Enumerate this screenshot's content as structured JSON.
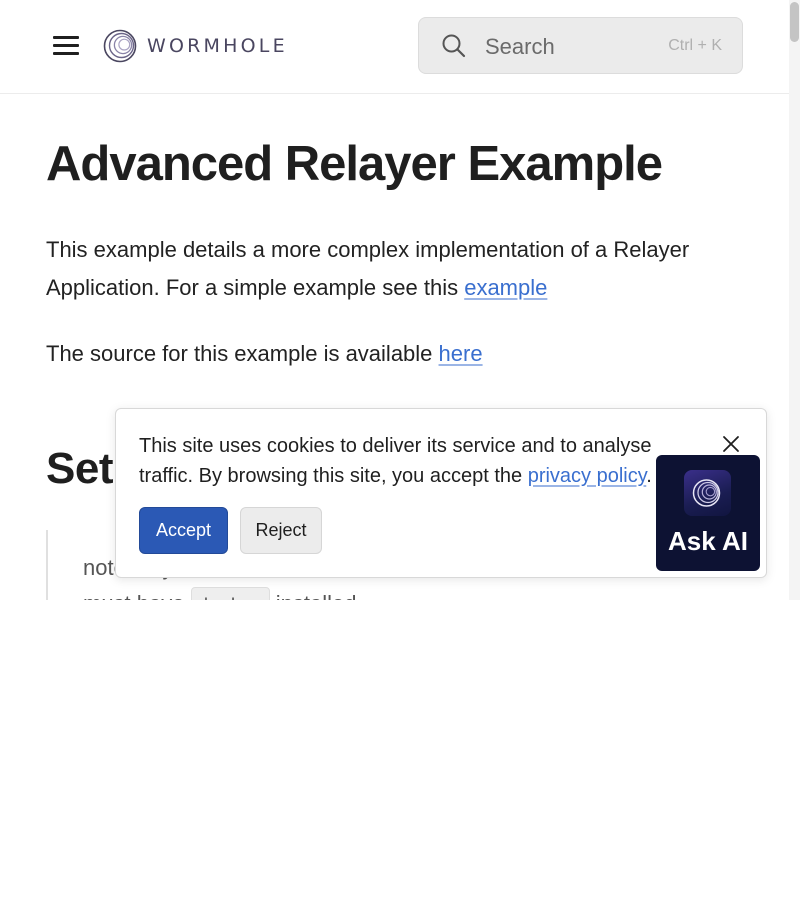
{
  "header": {
    "brand": "WORMHOLE",
    "search": {
      "placeholder": "Search",
      "shortcut": "Ctrl + K"
    }
  },
  "main": {
    "title": "Advanced Relayer Example",
    "intro_text": "This example details a more complex implementation of a Relayer Application. For a simple example see this ",
    "intro_link": "example",
    "source_text": "The source for this example is available ",
    "source_link": "here",
    "setup_heading": "Setup",
    "note_line1": "note: ... you must have",
    "note_line2_pre": "must have ",
    "note_code": "docker",
    "note_line2_post": " installed"
  },
  "cookie_banner": {
    "text": "This site uses cookies to deliver its service and to analyse traffic. By browsing this site, you accept the ",
    "link": "privacy policy",
    "text_end": ".",
    "accept_label": "Accept",
    "reject_label": "Reject"
  },
  "ask_ai": {
    "label": "Ask AI"
  },
  "colors": {
    "link": "#3a6fcf",
    "accept_button": "#2b59b5",
    "ask_ai_background": "#0d1233"
  }
}
